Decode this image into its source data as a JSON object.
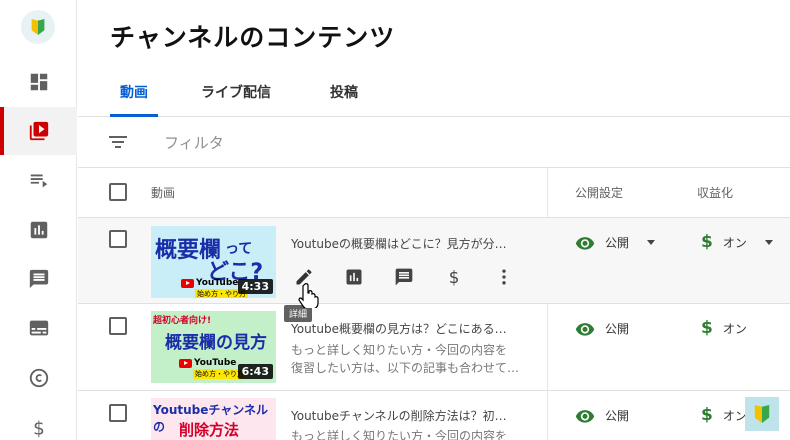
{
  "page": {
    "title": "チャンネルのコンテンツ"
  },
  "tabs": [
    {
      "label": "動画",
      "active": true
    },
    {
      "label": "ライブ配信",
      "active": false
    },
    {
      "label": "投稿",
      "active": false
    }
  ],
  "filter": {
    "placeholder": "フィルタ"
  },
  "table": {
    "headers": {
      "video": "動画",
      "visibility": "公開設定",
      "monetization": "収益化"
    },
    "rows": [
      {
        "thumb_line1": "概要欄",
        "thumb_line1b": "って",
        "thumb_line2": "どこ?",
        "thumb_brand": "YouTube",
        "thumb_sub": "始め方・やり方",
        "duration": "4:33",
        "title": "Youtubeの概要欄はどこに？見方が分…",
        "desc": [
          "",
          ""
        ],
        "visibility": "公開",
        "monetization": "オン"
      },
      {
        "thumb_tag": "超初心者向け!",
        "thumb_line1": "概要欄の見方",
        "thumb_brand": "YouTube",
        "thumb_sub": "始め方・やり方",
        "duration": "6:43",
        "title": "Youtube概要欄の見方は？どこにある…",
        "desc": [
          "もっと詳しく知りたい方・今回の内容を",
          "復習したい方は、以下の記事も合わせて…"
        ],
        "visibility": "公開",
        "monetization": "オン"
      },
      {
        "thumb_line1": "Youtubeチャンネルの",
        "thumb_line2": "削除方法",
        "title": "Youtubeチャンネルの削除方法は？初…",
        "desc": [
          "もっと詳しく知りたい方・今回の内容を",
          ""
        ],
        "visibility": "公開",
        "monetization": "オン"
      }
    ]
  },
  "tooltip": "詳細",
  "colors": {
    "accent": "#065fd4",
    "active_rail": "#cc0000",
    "visibility_icon": "#2e7d32",
    "money": "#2e7d32"
  }
}
